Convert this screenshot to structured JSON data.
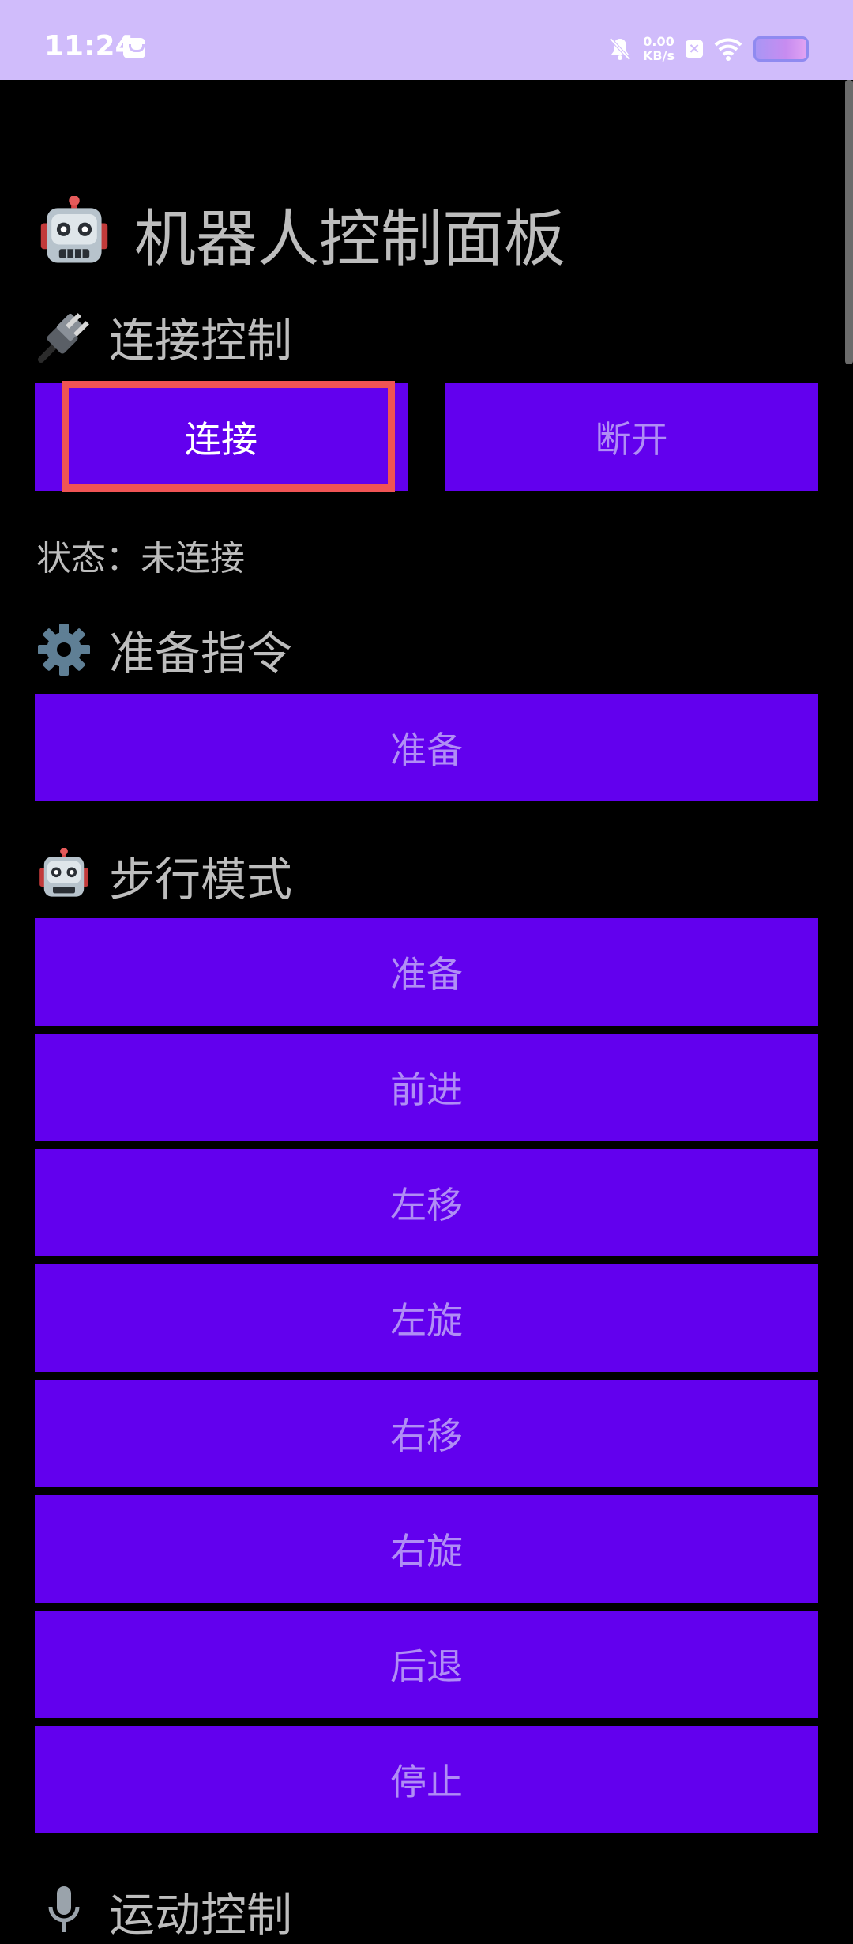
{
  "statusbar": {
    "time": "11:24",
    "speed_value": "0.00",
    "speed_unit": "KB/s",
    "icons": [
      "message-icon",
      "bell-muted-icon",
      "close-box-icon",
      "wifi-icon",
      "battery-icon"
    ]
  },
  "page": {
    "title": "机器人控制面板",
    "title_icon": "robot-icon"
  },
  "connect": {
    "heading": "连接控制",
    "heading_icon": "plug-icon",
    "connect_label": "连接",
    "disconnect_label": "断开",
    "status_text": "状态：未连接"
  },
  "prepare": {
    "heading": "准备指令",
    "heading_icon": "gear-icon",
    "button_label": "准备"
  },
  "step": {
    "heading": "步行模式",
    "heading_icon": "robot-icon",
    "buttons": [
      "准备",
      "前进",
      "左移",
      "左旋",
      "右移",
      "右旋",
      "后退",
      "停止"
    ]
  },
  "motion": {
    "heading": "运动控制",
    "heading_icon": "microphone-icon"
  },
  "colors": {
    "button_bg": "#6200ee",
    "statusbar_bg": "#d0bcfb",
    "highlight": "#f05454",
    "page_bg": "#000000"
  }
}
